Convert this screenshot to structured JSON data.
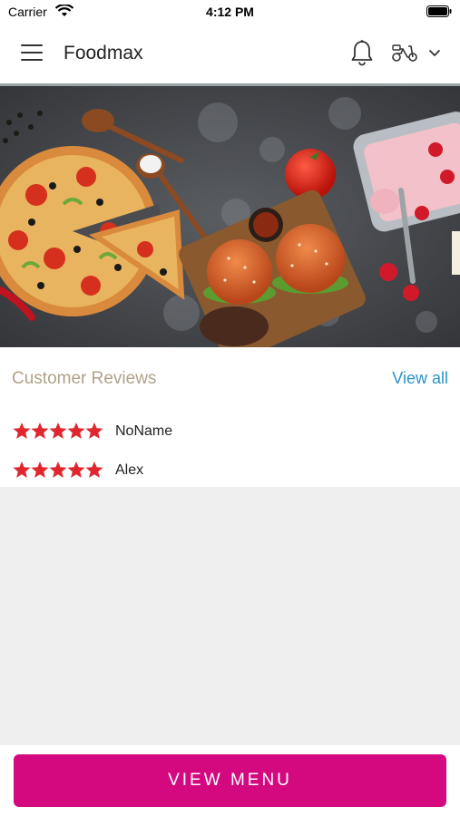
{
  "status_bar": {
    "carrier": "Carrier",
    "time": "4:12 PM"
  },
  "header": {
    "title": "Foodmax"
  },
  "reviews": {
    "title": "Customer Reviews",
    "view_all": "View all",
    "items": [
      {
        "name": "NoName",
        "rating": 5
      },
      {
        "name": "Alex",
        "rating": 5
      }
    ]
  },
  "footer": {
    "view_menu_label": "VIEW MENU"
  },
  "colors": {
    "accent": "#d4087f",
    "link": "#2a93c9",
    "star": "#e0262f",
    "reviews_title": "#b0a18a"
  },
  "icons": [
    "menu-icon",
    "bell-icon",
    "scooter-icon",
    "chevron-down-icon",
    "wifi-icon",
    "battery-icon",
    "star-icon"
  ]
}
